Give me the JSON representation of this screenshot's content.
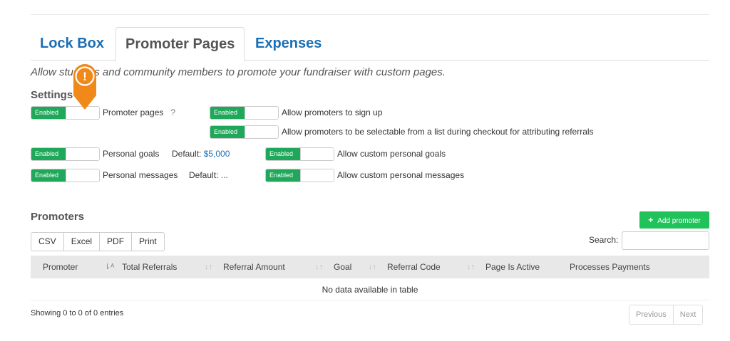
{
  "tabs": [
    {
      "label": "Lock Box"
    },
    {
      "label": "Promoter Pages"
    },
    {
      "label": "Expenses"
    }
  ],
  "intro": "Allow students and community members to promote your fundraiser with custom pages.",
  "settings": {
    "title": "Settings",
    "toggle_label": "Enabled",
    "promoter_pages": {
      "label": "Promoter pages",
      "help": "?"
    },
    "allow_signup": "Allow promoters to sign up",
    "allow_selectable": "Allow promoters to be selectable from a list during checkout for attributing referrals",
    "personal_goals": {
      "label": "Personal goals",
      "default_label": "Default:",
      "default_value": "$5,000"
    },
    "allow_custom_goals": "Allow custom personal goals",
    "personal_messages": {
      "label": "Personal messages",
      "default_label": "Default:",
      "default_value": "..."
    },
    "allow_custom_messages": "Allow custom personal messages"
  },
  "promoters": {
    "title": "Promoters",
    "add_button": "Add promoter",
    "add_icon": "+",
    "export": [
      "CSV",
      "Excel",
      "PDF",
      "Print"
    ],
    "search_label": "Search:",
    "search_value": "",
    "columns": [
      "Promoter",
      "Total Referrals",
      "Referral Amount",
      "Goal",
      "Referral Code",
      "Page Is Active",
      "Processes Payments"
    ],
    "empty": "No data available in table",
    "info": "Showing 0 to 0 of 0 entries",
    "pager": {
      "previous": "Previous",
      "next": "Next"
    }
  },
  "marker": {
    "icon": "alert-pin-icon",
    "glyph": "!",
    "color": "#f0891a"
  },
  "colors": {
    "accent": "#1a6fb5",
    "enabled": "#1fa85a",
    "add": "#1fc35a"
  }
}
